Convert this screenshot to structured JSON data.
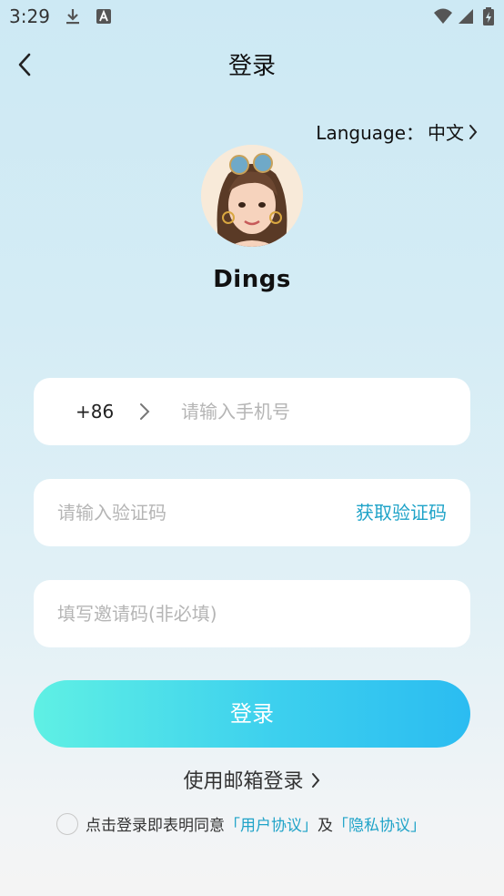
{
  "status_bar": {
    "time": "3:29",
    "left_icons": [
      "download-icon",
      "keyboard-a-icon"
    ],
    "right_icons": [
      "wifi-icon",
      "signal-icon",
      "battery-icon"
    ]
  },
  "header": {
    "title": "登录",
    "back_icon": "chevron-left-icon"
  },
  "language": {
    "label": "Language：",
    "value": "中文"
  },
  "app": {
    "name": "Dings"
  },
  "phone_field": {
    "country_code": "+86",
    "placeholder": "请输入手机号"
  },
  "code_field": {
    "placeholder": "请输入验证码",
    "get_code_label": "获取验证码"
  },
  "invite_field": {
    "placeholder": "填写邀请码(非必填)"
  },
  "login_button": "登录",
  "email_login": "使用邮箱登录",
  "agreement": {
    "prefix": "点击登录即表明同意",
    "user_agreement": "「用户协议」",
    "and": "及",
    "privacy": "「隐私协议」"
  },
  "colors": {
    "accent": "#1fa3c8",
    "button_start": "#5ff0e4",
    "button_end": "#2bbcf1"
  }
}
